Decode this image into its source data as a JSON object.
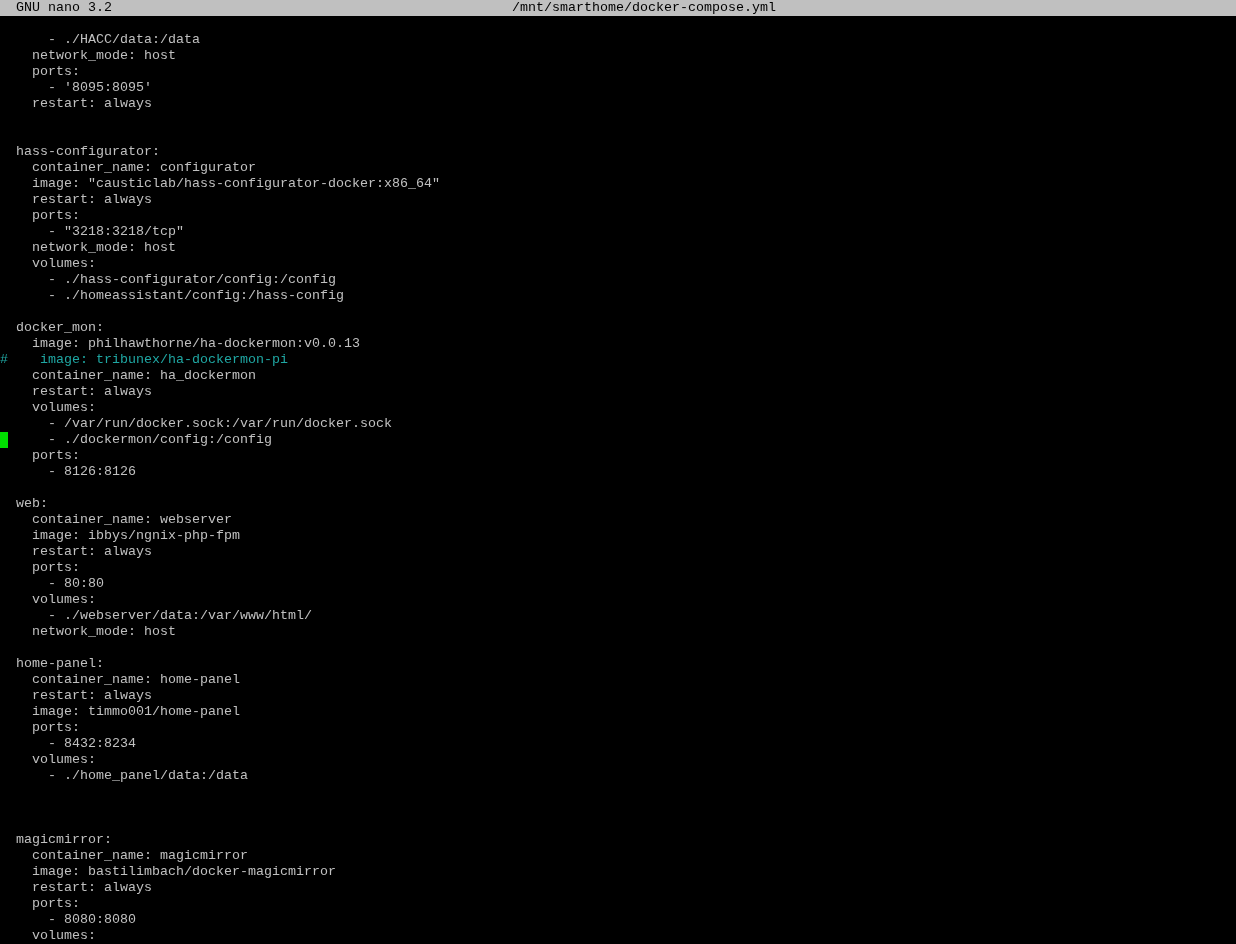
{
  "title_bar": {
    "app": "GNU nano 3.2",
    "file": "/mnt/smarthome/docker-compose.yml"
  },
  "lines": [
    {
      "kind": "blank",
      "cursor": false
    },
    {
      "kind": "code",
      "text": "    - ./HACC/data:/data",
      "cursor": false
    },
    {
      "kind": "code",
      "text": "  network_mode: host",
      "cursor": false
    },
    {
      "kind": "code",
      "text": "  ports:",
      "cursor": false
    },
    {
      "kind": "code",
      "text": "    - '8095:8095'",
      "cursor": false
    },
    {
      "kind": "code",
      "text": "  restart: always",
      "cursor": false
    },
    {
      "kind": "blank",
      "cursor": false
    },
    {
      "kind": "blank",
      "cursor": false
    },
    {
      "kind": "code",
      "text": "hass-configurator:",
      "cursor": false
    },
    {
      "kind": "code",
      "text": "  container_name: configurator",
      "cursor": false
    },
    {
      "kind": "code",
      "text": "  image: \"causticlab/hass-configurator-docker:x86_64\"",
      "cursor": false
    },
    {
      "kind": "code",
      "text": "  restart: always",
      "cursor": false
    },
    {
      "kind": "code",
      "text": "  ports:",
      "cursor": false
    },
    {
      "kind": "code",
      "text": "    - \"3218:3218/tcp\"",
      "cursor": false
    },
    {
      "kind": "code",
      "text": "  network_mode: host",
      "cursor": false
    },
    {
      "kind": "code",
      "text": "  volumes:",
      "cursor": false
    },
    {
      "kind": "code",
      "text": "    - ./hass-configurator/config:/config",
      "cursor": false
    },
    {
      "kind": "code",
      "text": "    - ./homeassistant/config:/hass-config",
      "cursor": false
    },
    {
      "kind": "blank",
      "cursor": false
    },
    {
      "kind": "code",
      "text": "docker_mon:",
      "cursor": false
    },
    {
      "kind": "code",
      "text": "  image: philhawthorne/ha-dockermon:v0.0.13",
      "cursor": false
    },
    {
      "kind": "comment",
      "text": "#    image: tribunex/ha-dockermon-pi",
      "cursor": false
    },
    {
      "kind": "code",
      "text": "  container_name: ha_dockermon",
      "cursor": false
    },
    {
      "kind": "code",
      "text": "  restart: always",
      "cursor": false
    },
    {
      "kind": "code",
      "text": "  volumes:",
      "cursor": false
    },
    {
      "kind": "code",
      "text": "    - /var/run/docker.sock:/var/run/docker.sock",
      "cursor": false
    },
    {
      "kind": "code",
      "text": "    - ./dockermon/config:/config",
      "cursor": true
    },
    {
      "kind": "code",
      "text": "  ports:",
      "cursor": false
    },
    {
      "kind": "code",
      "text": "    - 8126:8126",
      "cursor": false
    },
    {
      "kind": "blank",
      "cursor": false
    },
    {
      "kind": "code",
      "text": "web:",
      "cursor": false
    },
    {
      "kind": "code",
      "text": "  container_name: webserver",
      "cursor": false
    },
    {
      "kind": "code",
      "text": "  image: ibbys/ngnix-php-fpm",
      "cursor": false
    },
    {
      "kind": "code",
      "text": "  restart: always",
      "cursor": false
    },
    {
      "kind": "code",
      "text": "  ports:",
      "cursor": false
    },
    {
      "kind": "code",
      "text": "    - 80:80",
      "cursor": false
    },
    {
      "kind": "code",
      "text": "  volumes:",
      "cursor": false
    },
    {
      "kind": "code",
      "text": "    - ./webserver/data:/var/www/html/",
      "cursor": false
    },
    {
      "kind": "code",
      "text": "  network_mode: host",
      "cursor": false
    },
    {
      "kind": "blank",
      "cursor": false
    },
    {
      "kind": "code",
      "text": "home-panel:",
      "cursor": false
    },
    {
      "kind": "code",
      "text": "  container_name: home-panel",
      "cursor": false
    },
    {
      "kind": "code",
      "text": "  restart: always",
      "cursor": false
    },
    {
      "kind": "code",
      "text": "  image: timmo001/home-panel",
      "cursor": false
    },
    {
      "kind": "code",
      "text": "  ports:",
      "cursor": false
    },
    {
      "kind": "code",
      "text": "    - 8432:8234",
      "cursor": false
    },
    {
      "kind": "code",
      "text": "  volumes:",
      "cursor": false
    },
    {
      "kind": "code",
      "text": "    - ./home_panel/data:/data",
      "cursor": false
    },
    {
      "kind": "blank",
      "cursor": false
    },
    {
      "kind": "blank",
      "cursor": false
    },
    {
      "kind": "blank",
      "cursor": false
    },
    {
      "kind": "code",
      "text": "magicmirror:",
      "cursor": false
    },
    {
      "kind": "code",
      "text": "  container_name: magicmirror",
      "cursor": false
    },
    {
      "kind": "code",
      "text": "  image: bastilimbach/docker-magicmirror",
      "cursor": false
    },
    {
      "kind": "code",
      "text": "  restart: always",
      "cursor": false
    },
    {
      "kind": "code",
      "text": "  ports:",
      "cursor": false
    },
    {
      "kind": "code",
      "text": "    - 8080:8080",
      "cursor": false
    },
    {
      "kind": "code",
      "text": "  volumes:",
      "cursor": false
    }
  ]
}
